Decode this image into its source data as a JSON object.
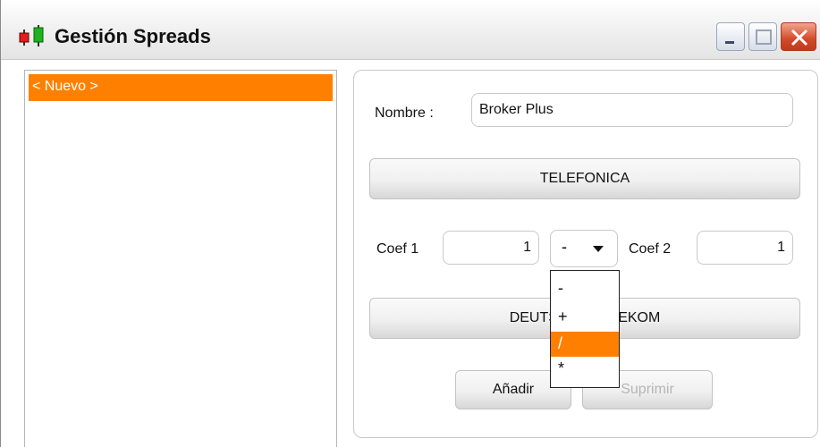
{
  "window": {
    "title": "Gestión Spreads",
    "controls": [
      "minimize-icon",
      "maximize-icon",
      "close-icon"
    ]
  },
  "list": {
    "items": [
      {
        "label": "< Nuevo >",
        "selected": true
      }
    ]
  },
  "form": {
    "nombre_label": "Nombre :",
    "nombre_value": "Broker Plus",
    "asset1_label": "TELEFONICA",
    "coef1_label": "Coef 1",
    "coef1_value": "1",
    "operator_value": "-",
    "coef2_label": "Coef 2",
    "coef2_value": "1",
    "asset2_label": "DEUTSCHE TELEKOM"
  },
  "operator_options": {
    "items": [
      "-",
      "+",
      "/",
      "*"
    ],
    "highlighted": "/"
  },
  "actions": {
    "add_label": "Añadir",
    "delete_label": "Suprimir",
    "delete_enabled": false
  },
  "colors": {
    "accent": "#ff8000",
    "close_button": "#d24a2a"
  }
}
